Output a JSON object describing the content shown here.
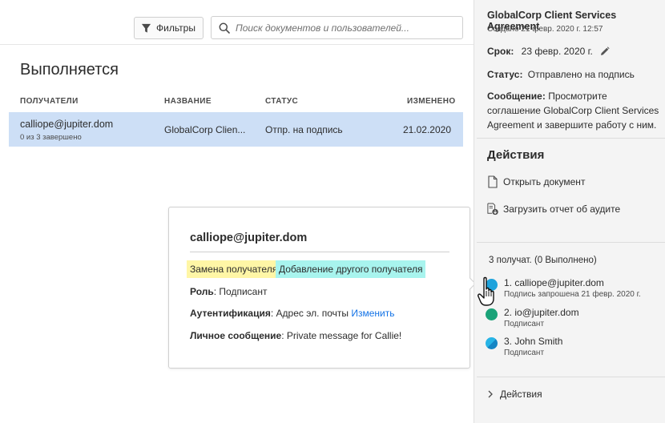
{
  "toolbar": {
    "filters_label": "Фильтры",
    "search_placeholder": "Поиск документов и пользователей..."
  },
  "main": {
    "section_title": "Выполняется",
    "columns": {
      "recipients": "ПОЛУЧАТЕЛИ",
      "name": "НАЗВАНИЕ",
      "status": "СТАТУС",
      "modified": "ИЗМЕНЕНО"
    },
    "rows": [
      {
        "recipient": "calliope@jupiter.dom",
        "progress": "0 из 3 завершено",
        "name": "GlobalCorp Clien...",
        "status": "Отпр. на подпись",
        "modified": "21.02.2020"
      }
    ]
  },
  "popup": {
    "email": "calliope@jupiter.dom",
    "replace_label": "Замена получателя",
    "add_label": "Добавление другого получателя",
    "role_label": "Роль",
    "role_value": ": Подписант",
    "auth_label": "Аутентификация",
    "auth_value": ": Адрес эл. почты ",
    "auth_change": "Изменить",
    "message_label": "Личное сообщение",
    "message_value": ": Private message for Callie!"
  },
  "panel": {
    "title": "GlobalCorp Client Services Agreement",
    "created": "Создано 21 февр. 2020 г. 12:57",
    "deadline_label": "Срок:",
    "deadline_value": "23 февр. 2020 г.",
    "status_label": "Статус:",
    "status_value": "Отправлено на подпись",
    "message_label": "Сообщение:",
    "message_value": "Просмотрите соглашение GlobalCorp Client Services Agreement и завершите работу с ним.",
    "actions_heading": "Действия",
    "action_open": "Открыть документ",
    "action_audit": "Загрузить отчет об аудите",
    "recipients_count": "3 получат. (0 Выполнено)",
    "recipients": [
      {
        "name": "1. calliope@jupiter.dom",
        "sub": "Подпись запрошена 21 февр. 2020 г.",
        "color": "#1fa3dc"
      },
      {
        "name": "2. io@jupiter.dom",
        "sub": "Подписант",
        "color": "#1aa278"
      },
      {
        "name": "3. John Smith",
        "sub": "Подписант",
        "color": "#1f9fdc"
      }
    ],
    "bottom_actions": "Действия"
  },
  "colors": {
    "selected_row": "#cddff6",
    "link": "#1473e6",
    "replace_chip": "#fff6a6",
    "add_chip": "#a8f4ee"
  }
}
